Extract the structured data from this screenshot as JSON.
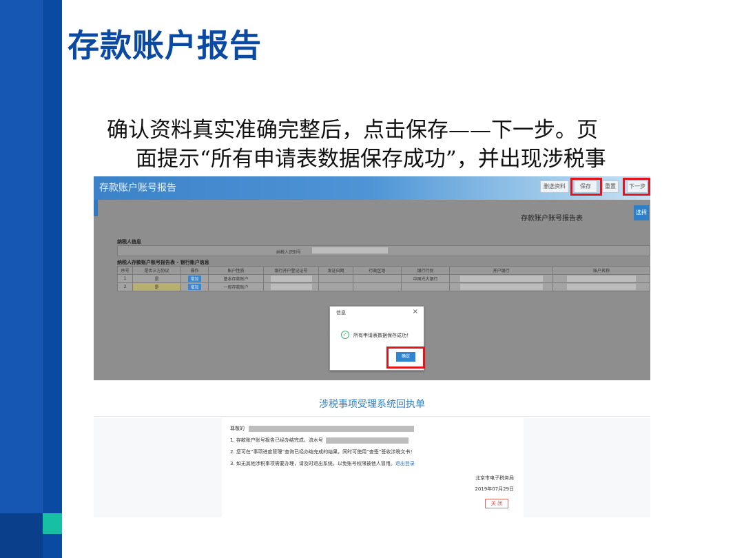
{
  "slide": {
    "title": "存款账户报告",
    "body_line1": "确认资料真实准确完整后，点击保存——下一步。页",
    "body_line2": "面提示“所有申请表数据保存成功”，并出现涉税事"
  },
  "screen1": {
    "app_title": "存款账户账号报告",
    "toolbar": {
      "prev_label": "删选资料",
      "save_label": "保存",
      "reset_label": "重置",
      "next_label": "下一步"
    },
    "form_title": "存款账户账号报告表",
    "side_button": "选择",
    "taxpayer_section": "纳税人信息",
    "taxpayer_id_label": "纳税人识别号",
    "bank_section": "纳税人存款账户账号报告表 - 银行账户信息",
    "table_headers": [
      "序号",
      "是否三方协议",
      "操作",
      "账户性质",
      "银行开户登记证号",
      "发证日期",
      "行政区划",
      "银行行别",
      "开户银行",
      "账户名称"
    ],
    "rows": [
      {
        "no": "1",
        "tripartite": "是",
        "action": "增加",
        "account_type": "基本存款账户"
      },
      {
        "no": "2",
        "tripartite": "是",
        "action": "增加",
        "account_type": "一般存款账户"
      }
    ],
    "bank_name_row1": "中国光大银行",
    "dialog": {
      "title": "信息",
      "close": "×",
      "message": "所有申请表数据保存成功！",
      "confirm": "确定"
    }
  },
  "screen2": {
    "title": "涉税事项受理系统回执单",
    "greeting": "尊敬的",
    "line1": "1. 存款账户账号报告已经办结完成，流水号",
    "line2": "2. 您可在“事项进度管理”查询已经办结完成的结果，同时可使用“查签”签收涉税文书！",
    "line3_prefix": "3. 如无其他涉税事项需要办理，请及时退出系统，以免账号权限被他人冒用。",
    "line3_link": "退出登录",
    "authority": "北京市电子税务局",
    "date": "2019年07月29日",
    "close_button": "关 闭"
  }
}
